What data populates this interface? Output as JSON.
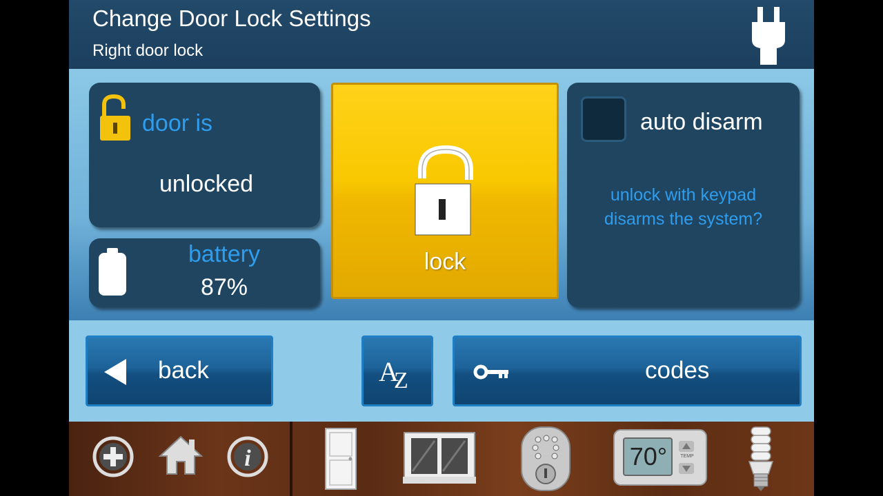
{
  "header": {
    "title": "Change Door Lock Settings",
    "subtitle": "Right door lock",
    "plug_icon": "power-plug-icon"
  },
  "door_status": {
    "label": "door is",
    "state": "unlocked",
    "icon": "padlock-open-icon"
  },
  "battery": {
    "label": "battery",
    "value": "87%",
    "level_percent": 87,
    "icon": "battery-icon"
  },
  "lock_button": {
    "label": "lock",
    "icon": "padlock-open-icon"
  },
  "auto_disarm": {
    "label": "auto disarm",
    "checked": false,
    "question_line1": "unlock with keypad",
    "question_line2": "disarms the system?"
  },
  "buttons": {
    "back_label": "back",
    "sort_label_a": "A",
    "sort_label_z": "Z",
    "codes_label": "codes"
  },
  "bottom_nav": {
    "thermostat_temp": "70°",
    "thermostat_small_label": "TEMP",
    "items": [
      "add-icon",
      "home-icon",
      "info-icon",
      "door-icon",
      "window-icon",
      "deadbolt-keypad-icon",
      "thermostat-icon",
      "light-bulb-icon"
    ]
  },
  "colors": {
    "header_bg": "#1f4561",
    "panel_bg": "#1f4561",
    "accent_blue": "#2f9dee",
    "lock_yellow": "#f8c800",
    "button_blue": "#1d6399"
  }
}
